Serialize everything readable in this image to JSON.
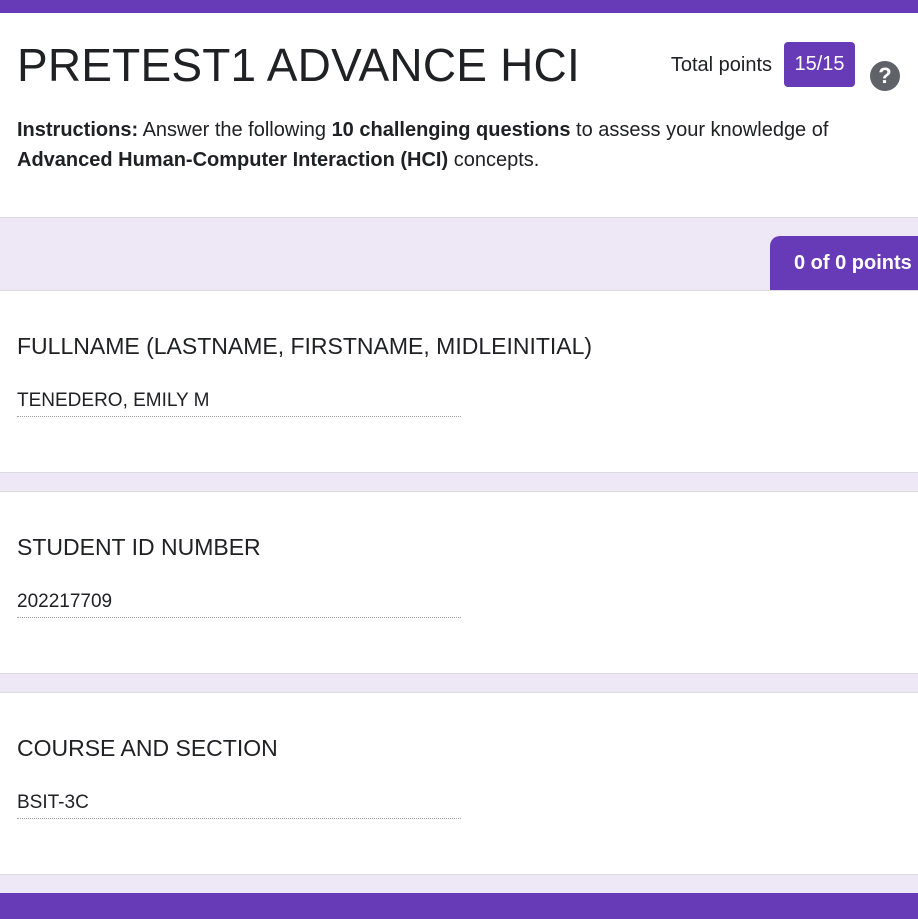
{
  "form": {
    "title": "PRETEST1 ADVANCE HCI",
    "total_points_label": "Total points",
    "score": "15/15",
    "help_glyph": "?",
    "instructions": {
      "label": "Instructions:",
      "text_1": " Answer the following ",
      "bold_1": "10 challenging questions",
      "text_2": " to assess your knowledge of ",
      "bold_2": "Advanced Human-Computer Interaction (HCI)",
      "text_3": " concepts."
    }
  },
  "section": {
    "points_label": "0 of 0 points"
  },
  "questions": [
    {
      "title": "FULLNAME (LASTNAME, FIRSTNAME, MIDLEINITIAL)",
      "answer": "TENEDERO, EMILY M"
    },
    {
      "title": "STUDENT ID NUMBER",
      "answer": "202217709"
    },
    {
      "title": "COURSE AND SECTION",
      "answer": "BSIT-3C"
    }
  ],
  "theme": {
    "accent_color": "#673ab7",
    "background_color": "#ede7f6",
    "icons": [
      "help-icon"
    ]
  }
}
